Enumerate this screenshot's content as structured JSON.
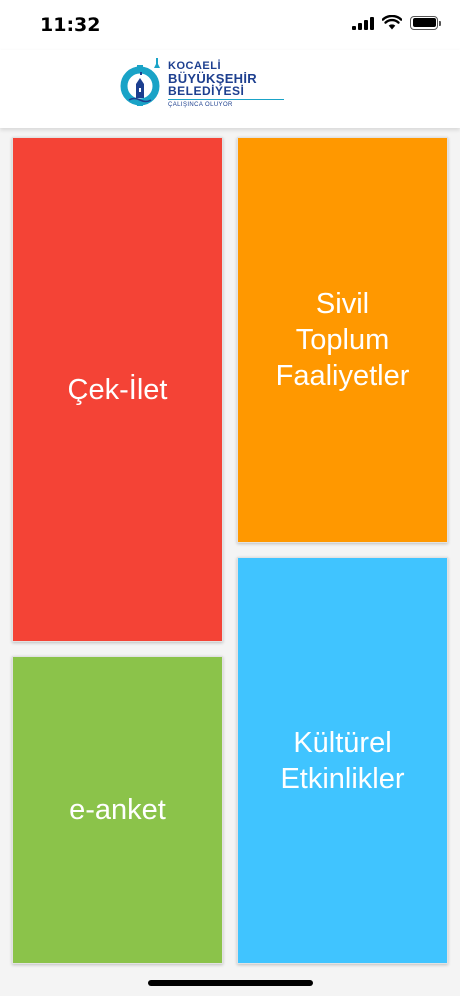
{
  "status_bar": {
    "time": "11:32",
    "icons": [
      "signal-icon",
      "wifi-icon",
      "battery-icon"
    ]
  },
  "header": {
    "logo": {
      "line1": "KOCAELİ",
      "line2": "BÜYÜKŞEHİR",
      "line3": "BELEDİYESİ",
      "slogan": "ÇALIŞINCA OLUYOR"
    }
  },
  "tiles": {
    "cek_ilet": {
      "label": "Çek-İlet",
      "color": "#f44336"
    },
    "sivil_toplum": {
      "label": "Sivil\nToplum\nFaaliyetler",
      "color": "#ff9800"
    },
    "e_anket": {
      "label": "e-anket",
      "color": "#8bc34a"
    },
    "kulturel": {
      "label": "Kültürel\nEtkinlikler",
      "color": "#40c4ff"
    }
  },
  "colors": {
    "logo_blue": "#1d3f8f",
    "logo_teal": "#1aa3c7"
  }
}
